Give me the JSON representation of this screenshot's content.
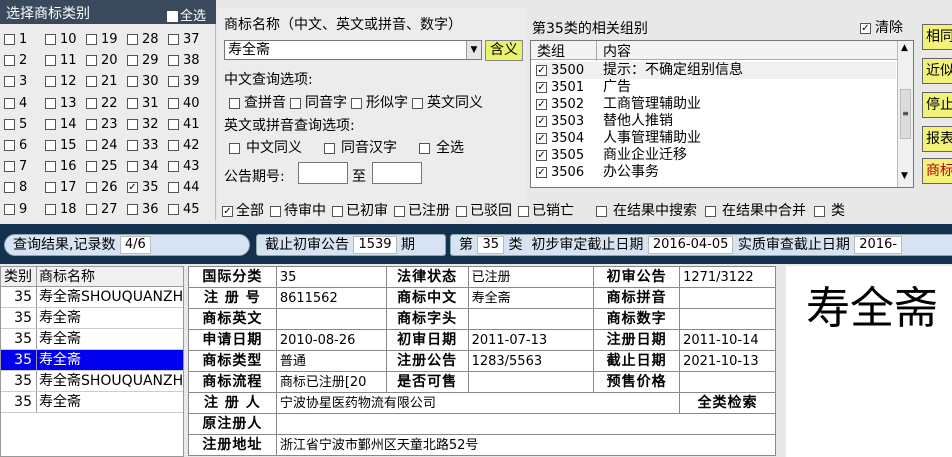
{
  "category_panel": {
    "title": "选择商标类别",
    "select_all": "全选",
    "columns": [
      [
        {
          "n": "1",
          "c": false
        },
        {
          "n": "2",
          "c": false
        },
        {
          "n": "3",
          "c": false
        },
        {
          "n": "4",
          "c": false
        },
        {
          "n": "5",
          "c": false
        },
        {
          "n": "6",
          "c": false
        },
        {
          "n": "7",
          "c": false
        },
        {
          "n": "8",
          "c": false
        },
        {
          "n": "9",
          "c": false
        }
      ],
      [
        {
          "n": "10",
          "c": false
        },
        {
          "n": "11",
          "c": false
        },
        {
          "n": "12",
          "c": false
        },
        {
          "n": "13",
          "c": false
        },
        {
          "n": "14",
          "c": false
        },
        {
          "n": "15",
          "c": false
        },
        {
          "n": "16",
          "c": false
        },
        {
          "n": "17",
          "c": false
        },
        {
          "n": "18",
          "c": false
        }
      ],
      [
        {
          "n": "19",
          "c": false
        },
        {
          "n": "20",
          "c": false
        },
        {
          "n": "21",
          "c": false
        },
        {
          "n": "22",
          "c": false
        },
        {
          "n": "23",
          "c": false
        },
        {
          "n": "24",
          "c": false
        },
        {
          "n": "25",
          "c": false
        },
        {
          "n": "26",
          "c": false
        },
        {
          "n": "27",
          "c": false
        }
      ],
      [
        {
          "n": "28",
          "c": false
        },
        {
          "n": "29",
          "c": false
        },
        {
          "n": "30",
          "c": false
        },
        {
          "n": "31",
          "c": false
        },
        {
          "n": "32",
          "c": false
        },
        {
          "n": "33",
          "c": false
        },
        {
          "n": "34",
          "c": false
        },
        {
          "n": "35",
          "c": true
        },
        {
          "n": "36",
          "c": false
        }
      ],
      [
        {
          "n": "37",
          "c": false
        },
        {
          "n": "38",
          "c": false
        },
        {
          "n": "39",
          "c": false
        },
        {
          "n": "40",
          "c": false
        },
        {
          "n": "41",
          "c": false
        },
        {
          "n": "42",
          "c": false
        },
        {
          "n": "43",
          "c": false
        },
        {
          "n": "44",
          "c": false
        },
        {
          "n": "45",
          "c": false
        }
      ]
    ]
  },
  "search": {
    "name_label": "商标名称（中文、英文或拼音、数字）",
    "name_value": "寿全斋",
    "hanyi_button": "含义",
    "cn_options_label": "中文查询选项:",
    "cn_options": [
      "查拼音",
      "同音字",
      "形似字",
      "英文同义"
    ],
    "en_options_label": "英文或拼音查询选项:",
    "en_options": [
      "中文同义",
      "同音汉字",
      "全选"
    ],
    "gazette_label": "公告期号:",
    "gazette_to": "至"
  },
  "groups": {
    "title": "第35类的相关组别",
    "clear_label": "清除",
    "col_group": "类组",
    "col_content": "内容",
    "rows": [
      {
        "code": "3500",
        "text": "提示：不确定组别信息"
      },
      {
        "code": "3501",
        "text": "广告"
      },
      {
        "code": "3502",
        "text": "工商管理辅助业"
      },
      {
        "code": "3503",
        "text": "替他人推销"
      },
      {
        "code": "3504",
        "text": "人事管理辅助业"
      },
      {
        "code": "3505",
        "text": "商业企业迁移"
      },
      {
        "code": "3506",
        "text": "办公事务"
      }
    ]
  },
  "right_buttons": [
    "相同",
    "近似",
    "停止",
    "报表",
    "商标"
  ],
  "filters": [
    {
      "label": "全部",
      "checked": true
    },
    {
      "label": "待审中",
      "checked": false
    },
    {
      "label": "已初审",
      "checked": false
    },
    {
      "label": "已注册",
      "checked": false
    },
    {
      "label": "已驳回",
      "checked": false
    },
    {
      "label": "已销亡",
      "checked": false
    }
  ],
  "extra_filters": [
    {
      "label": "在结果中搜索",
      "checked": false
    },
    {
      "label": "在结果中合并",
      "checked": false
    },
    {
      "label": "类",
      "checked": false
    }
  ],
  "status_bar": {
    "result_label": "查询结果,记录数",
    "result_count": "4/6",
    "deadline_label": "截止初审公告",
    "deadline_value": "1539",
    "deadline_unit": "期",
    "class_prefix": "第",
    "class_value": "35",
    "class_suffix": "类",
    "prelim_label": "初步审定截止日期",
    "prelim_value": "2016-04-05",
    "exam_label": "实质审查截止日期",
    "exam_value": "2016-"
  },
  "result_list": {
    "col_class": "类别",
    "col_name": "商标名称",
    "rows": [
      {
        "cls": "35",
        "name": "寿全斋SHOUQUANZHAI",
        "selected": false
      },
      {
        "cls": "35",
        "name": "寿全斋",
        "selected": false
      },
      {
        "cls": "35",
        "name": "寿全斋",
        "selected": false
      },
      {
        "cls": "35",
        "name": "寿全斋",
        "selected": true
      },
      {
        "cls": "35",
        "name": "寿全斋SHOUQUANZHAI",
        "selected": false
      },
      {
        "cls": "35",
        "name": "寿全斋",
        "selected": false
      }
    ]
  },
  "detail": {
    "intl_class_k": "国际分类",
    "intl_class_v": "35",
    "legal_status_k": "法律状态",
    "legal_status_v": "已注册",
    "prelim_pub_k": "初审公告",
    "prelim_pub_v": "1271/3122",
    "reg_no_k": "注 册 号",
    "reg_no_v": "8611562",
    "tm_cn_k": "商标中文",
    "tm_cn_v": "寿全斋",
    "tm_pinyin_k": "商标拼音",
    "tm_pinyin_v": "",
    "tm_en_k": "商标英文",
    "tm_en_v": "",
    "tm_head_k": "商标字头",
    "tm_head_v": "",
    "tm_digit_k": "商标数字",
    "tm_digit_v": "",
    "apply_date_k": "申请日期",
    "apply_date_v": "2010-08-26",
    "prelim_date_k": "初审日期",
    "prelim_date_v": "2011-07-13",
    "reg_date_k": "注册日期",
    "reg_date_v": "2011-10-14",
    "tm_type_k": "商标类型",
    "tm_type_v": "普通",
    "reg_pub_k": "注册公告",
    "reg_pub_v": "1283/5563",
    "expire_k": "截止日期",
    "expire_v": "2021-10-13",
    "flow_k": "商标流程",
    "flow_v": "商标已注册[20",
    "for_sale_k": "是否可售",
    "for_sale_v": "",
    "presale_k": "预售价格",
    "presale_v": "",
    "registrant_k": "注 册 人",
    "registrant_v": "宁波协星医药物流有限公司",
    "all_class_search": "全类检索",
    "orig_registrant_k": "原注册人",
    "orig_registrant_v": "",
    "address_k": "注册地址",
    "address_v": "浙江省宁波市鄞州区天童北路52号"
  },
  "preview": {
    "text": "寿全斋"
  }
}
